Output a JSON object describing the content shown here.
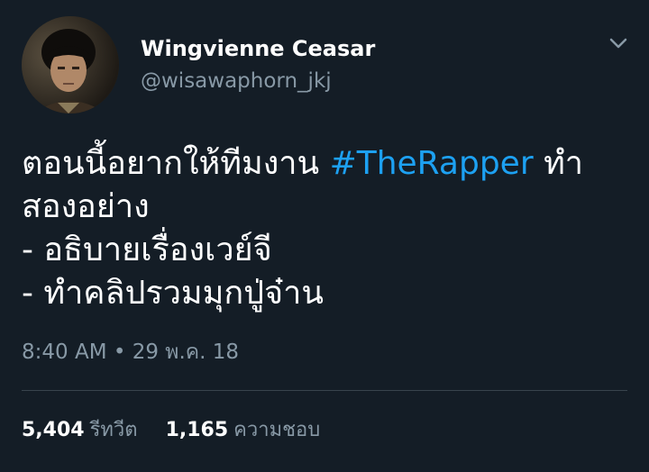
{
  "author": {
    "display_name": "Wingvienne Ceasar",
    "handle": "@wisawaphorn_jkj"
  },
  "tweet": {
    "line1_before_hashtag": "ตอนนี้อยากให้ทีมงาน ",
    "hashtag": "#TheRapper",
    "line1_after_hashtag": " ทำ",
    "line2": "สองอย่าง",
    "line3": "- อธิบายเรื่องเวย์จี",
    "line4": "- ทำคลิปรวมมุกปู่จ๋าน"
  },
  "timestamp": "8:40 AM • 29 พ.ค. 18",
  "stats": {
    "retweets_count": "5,404",
    "retweets_label": "รีทวีต",
    "likes_count": "1,165",
    "likes_label": "ความชอบ"
  },
  "colors": {
    "background": "#141d26",
    "text_primary": "#ffffff",
    "text_secondary": "#8899a6",
    "accent": "#1da1f2",
    "divider": "#38444d"
  },
  "icons": {
    "menu": "chevron-down-icon"
  }
}
